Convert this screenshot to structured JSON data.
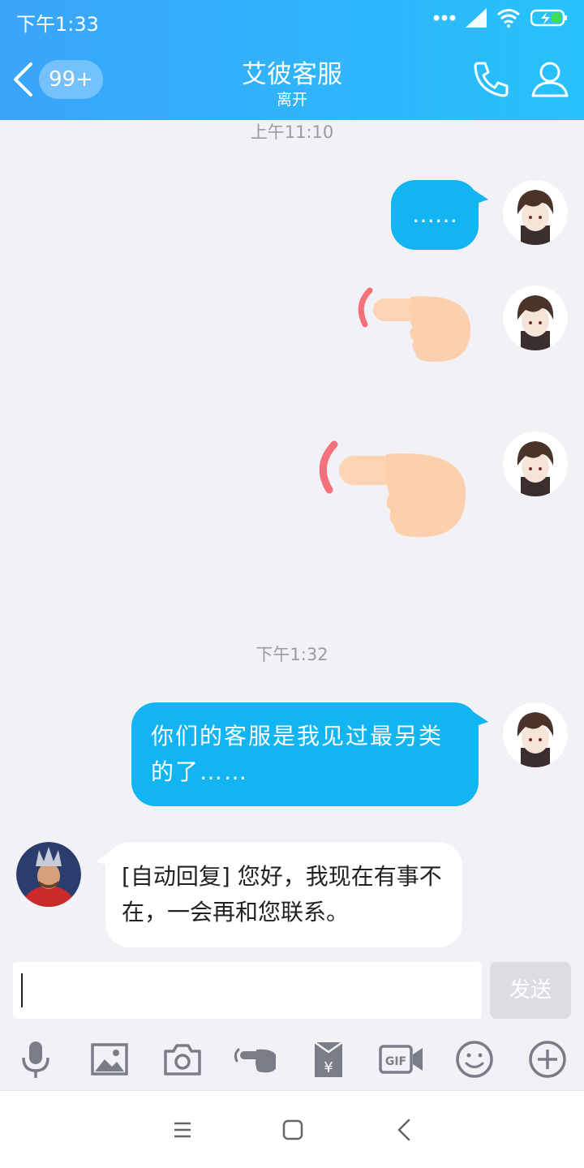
{
  "status_bar": {
    "time": "下午1:33"
  },
  "header": {
    "unread_badge": "99+",
    "title": "艾彼客服",
    "subtitle": "离开"
  },
  "chat": {
    "timestamp_1": "上午11:10",
    "message_1": "……",
    "timestamp_2": "下午1:32",
    "message_2": "你们的客服是我见过最另类的了……",
    "message_3": "[自动回复] 您好，我现在有事不在，一会再和您联系。"
  },
  "composer": {
    "input_value": "",
    "send_label": "发送"
  },
  "toolbar": {
    "icons": [
      "microphone-icon",
      "image-icon",
      "camera-icon",
      "poke-icon",
      "red-packet-icon",
      "gif-icon",
      "emoji-icon",
      "plus-icon"
    ]
  },
  "colors": {
    "header_gradient_start": "#3aa4fb",
    "header_gradient_end": "#27c2fb",
    "my_bubble": "#12b4f2",
    "send_disabled": "#dcdce2"
  }
}
